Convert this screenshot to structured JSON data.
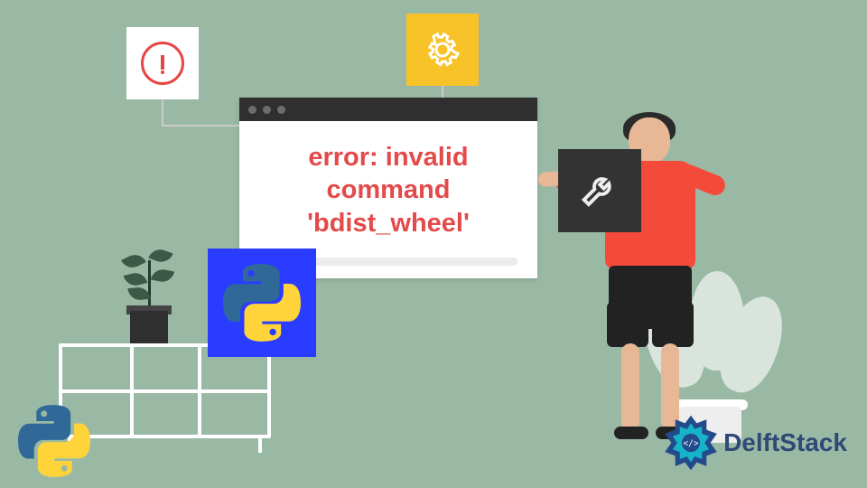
{
  "colors": {
    "background": "#9ab9a5",
    "accent_red": "#e34a4a",
    "accent_yellow": "#f8c229",
    "accent_blue": "#2a3cff",
    "titlebar": "#2f2f2f",
    "brand_navy": "#2e4a75"
  },
  "error_card": {
    "icon": "alert-circle-icon"
  },
  "gear_card": {
    "icon": "gear-icon"
  },
  "browser": {
    "title_dots": 3,
    "message_line1": "error: invalid",
    "message_line2": "command",
    "message_line3": "'bdist_wheel'"
  },
  "python_card": {
    "icon": "python-logo-icon"
  },
  "wrench_card": {
    "icon": "wrench-icon"
  },
  "brand": {
    "text": "DelftStack",
    "icon": "delftstack-logo-icon"
  },
  "corner_logo": {
    "icon": "python-logo-icon"
  }
}
